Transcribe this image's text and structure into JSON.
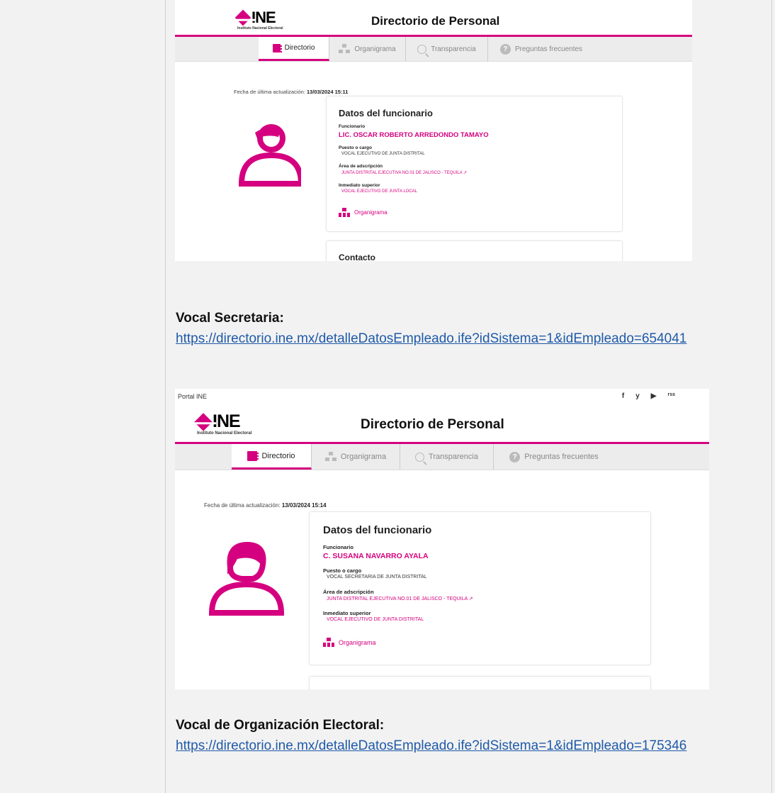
{
  "doc": {
    "heading1": "Vocal Secretaria:",
    "link1": "https://directorio.ine.mx/detalleDatosEmpleado.ife?idSistema=1&idEmpleado=654041",
    "heading2": "Vocal de Organización Electoral:",
    "link2": "https://directorio.ine.mx/detalleDatosEmpleado.ife?idSistema=1&idEmpleado=175346"
  },
  "shot1": {
    "logo_text": "INE",
    "logo_sub": "Instituto Nacional Electoral",
    "title": "Directorio de Personal",
    "nav": [
      "Directorio",
      "Organigrama",
      "Transparencia",
      "Preguntas frecuentes"
    ],
    "updated_label": "Fecha de última actualización:",
    "updated_value": "13/03/2024 15:11",
    "card_title": "Datos del funcionario",
    "funcionario_label": "Funcionario",
    "funcionario": "LIC. OSCAR ROBERTO ARREDONDO TAMAYO",
    "puesto_label": "Puesto o cargo",
    "puesto": "VOCAL EJECUTIVO DE JUNTA DISTRITAL",
    "area_label": "Área de adscripción",
    "area": "JUNTA DISTRITAL EJECUTIVA NO.01 DE JALISCO - TEQUILA",
    "superior_label": "Inmediato superior",
    "superior": "VOCAL EJECUTIVO DE JUNTA LOCAL",
    "org_link": "Organigrama",
    "contacto": "Contacto"
  },
  "shot2": {
    "portal": "Portal INE",
    "logo_text": "INE",
    "logo_sub": "Instituto Nacional Electoral",
    "title": "Directorio de Personal",
    "nav": [
      "Directorio",
      "Organigrama",
      "Transparencia",
      "Preguntas frecuentes"
    ],
    "updated_label": "Fecha de última actualización:",
    "updated_value": "13/03/2024 15:14",
    "card_title": "Datos del funcionario",
    "funcionario_label": "Funcionario",
    "funcionario": "C. SUSANA NAVARRO AYALA",
    "puesto_label": "Puesto o cargo",
    "puesto": "VOCAL SECRETARIA DE JUNTA DISTRITAL",
    "area_label": "Área de adscripción",
    "area": "JUNTA DISTRITAL EJECUTIVA NO.01 DE JALISCO - TEQUILA",
    "superior_label": "Inmediato superior",
    "superior": "VOCAL EJECUTIVO DE JUNTA DISTRITAL",
    "org_link": "Organigrama",
    "social": [
      "f",
      "y",
      "▶",
      "rss"
    ]
  },
  "colors": {
    "brand": "#d5007f",
    "link": "#1f5aa8"
  }
}
